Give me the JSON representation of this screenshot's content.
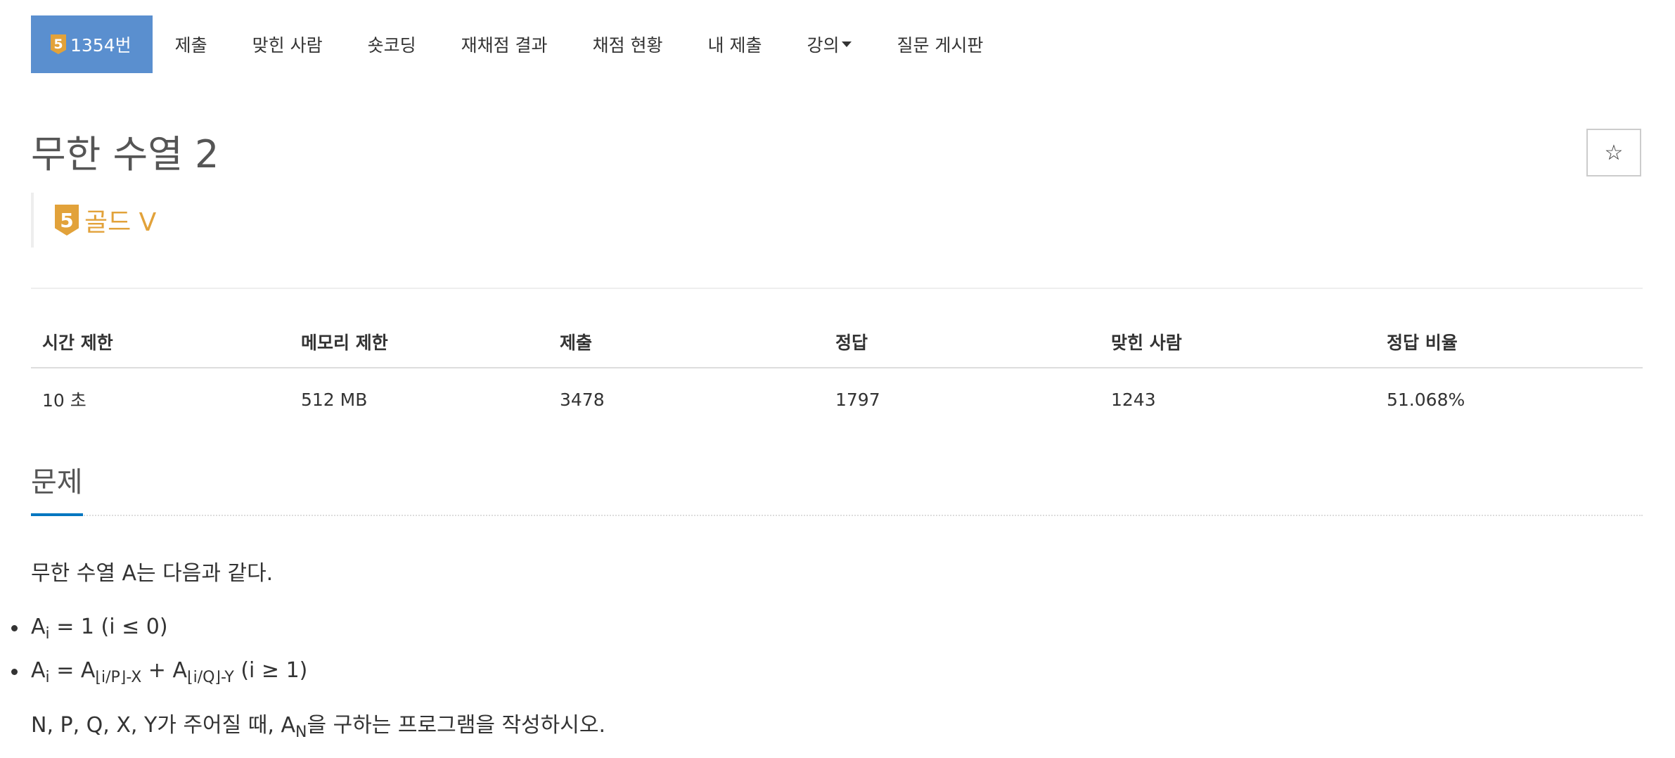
{
  "nav": {
    "tabs": [
      {
        "label": "1354번",
        "tier": "5",
        "active": true
      },
      {
        "label": "제출"
      },
      {
        "label": "맞힌 사람"
      },
      {
        "label": "숏코딩"
      },
      {
        "label": "재채점 결과"
      },
      {
        "label": "채점 현황"
      },
      {
        "label": "내 제출"
      },
      {
        "label": "강의"
      },
      {
        "label": "질문 게시판"
      }
    ]
  },
  "problem": {
    "title": "무한 수열 2",
    "star_icon": "☆",
    "tier": {
      "number": "5",
      "label": "골드 V",
      "color": "#e2a23a"
    }
  },
  "info_table": {
    "headers": [
      "시간 제한",
      "메모리 제한",
      "제출",
      "정답",
      "맞힌 사람",
      "정답 비율"
    ],
    "values": [
      "10 초",
      "512 MB",
      "3478",
      "1797",
      "1243",
      "51.068%"
    ]
  },
  "section": {
    "title": "문제",
    "intro": "무한 수열 A는 다음과 같다.",
    "bullets": [
      {
        "base": "A",
        "sub": "i",
        "rest": " = 1 (i ≤ 0)"
      },
      {
        "base": "A",
        "sub": "i",
        "mid": " = A",
        "sub2": "⌊i/P⌋-X",
        "mid2": " + A",
        "sub3": "⌊i/Q⌋-Y",
        "rest": " (i ≥ 1)"
      }
    ],
    "outro_pre": "N, P, Q, X, Y가 주어질 때, A",
    "outro_sub": "N",
    "outro_post": "을 구하는 프로그램을 작성하시오."
  },
  "colors": {
    "active_tab": "#5a8fcf",
    "tier_gold": "#e2a23a",
    "section_underline": "#0076c0"
  }
}
